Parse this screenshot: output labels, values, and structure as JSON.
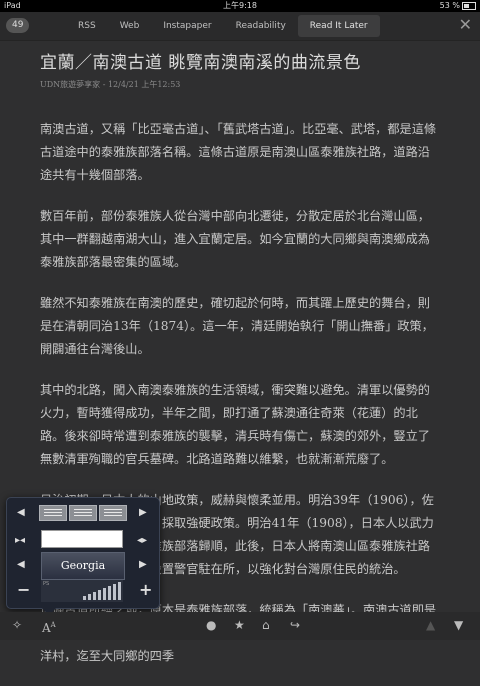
{
  "statusbar": {
    "left": "iPad",
    "time": "上午9:18",
    "battery": "53 %"
  },
  "topbar": {
    "count": "49",
    "tabs": [
      "RSS",
      "Web",
      "Instapaper",
      "Readability",
      "Read It Later"
    ],
    "selected_tab": "Read It Later"
  },
  "article": {
    "title": "宜蘭／南澳古道 眺覽南澳南溪的曲流景色",
    "byline": "UDN旅遊夢享家 - 12/4/21 上午12:53",
    "paragraphs": [
      "南澳古道，又稱「比亞毫古道」、「舊武塔古道」。比亞毫、武塔，都是這條古道途中的泰雅族部落名稱。這條古道原是南澳山區泰雅族社路，道路沿途共有十幾個部落。",
      "數百年前，部份泰雅族人從台灣中部向北遷徙，分散定居於北台灣山區，其中一群翻越南湖大山，進入宜蘭定居。如今宜蘭的大同鄉與南澳鄉成為泰雅族部落最密集的區域。",
      "雖然不知泰雅族在南澳的歷史，確切起於何時，而其躍上歷史的舞台，則是在清朝同治13年（1874）。這一年，清廷開始執行「開山撫番」政策，開闢通往台灣後山。",
      "其中的北路，闖入南澳泰雅族的生活領域，衝突難以避免。清軍以優勢的火力，暫時獲得成功，半年之間，即打通了蘇澳通往奇萊（花蓮）的北路。後來卻時常遭到泰雅族的襲擊，清兵時有傷亡，蘇澳的郊外，豎立了無數清軍殉職的官兵墓碑。北路道路難以維繫，也就漸漸荒廢了。",
      "日治初期，日本人的山地政策，威赫與懷柔並用。明治39年（1906），佐久間佐馬太總督上任，採取強硬政策。明治41年（1908），日本人以武力迫使大南澳地區的泰雅族部落歸順，此後，日本人將南澳山區泰雅族社路改修成警備道路，並設置警官駐在所，以強化對台灣原住民的統治。",
      "南澳古道即是日治時期日本人所修築的舊警備道路，起自今日南澳的金洋村，迄至大同鄉的四季"
    ],
    "paragraph6_lead": "這條古道所經之地，原本是泰雅族部落，統稱為「南澳蕃」。南澳古道即是日"
  },
  "popup": {
    "font_name": "Georgia",
    "size_label": "PS",
    "minus": "−",
    "plus": "+",
    "font_button": "A"
  },
  "bottombar": {
    "icons": [
      "sparkle-icon",
      "font-settings-icon",
      "dot-icon",
      "star-icon",
      "tag-icon",
      "share-icon",
      "prev-icon",
      "next-icon"
    ]
  }
}
